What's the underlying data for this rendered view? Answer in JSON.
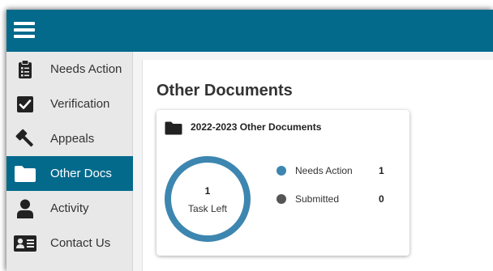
{
  "colors": {
    "accent": "#046a8c",
    "ring": "#3d86b0",
    "needs_action_dot": "#3d86b0",
    "submitted_dot": "#555555"
  },
  "header": {
    "menu_icon": "hamburger-menu-icon"
  },
  "sidebar": {
    "items": [
      {
        "label": "Needs Action",
        "icon": "clipboard-icon",
        "active": false
      },
      {
        "label": "Verification",
        "icon": "checkbox-icon",
        "active": false
      },
      {
        "label": "Appeals",
        "icon": "gavel-icon",
        "active": false
      },
      {
        "label": "Other Docs",
        "icon": "folder-icon",
        "active": true
      },
      {
        "label": "Activity",
        "icon": "person-icon",
        "active": false
      },
      {
        "label": "Contact Us",
        "icon": "contact-card-icon",
        "active": false
      }
    ]
  },
  "main": {
    "title": "Other Documents",
    "card": {
      "icon": "folder-icon",
      "title": "2022-2023 Other Documents",
      "tasks_left_count": "1",
      "tasks_left_label": "Task Left",
      "legend": [
        {
          "label": "Needs Action",
          "value": "1"
        },
        {
          "label": "Submitted",
          "value": "0"
        }
      ]
    }
  }
}
